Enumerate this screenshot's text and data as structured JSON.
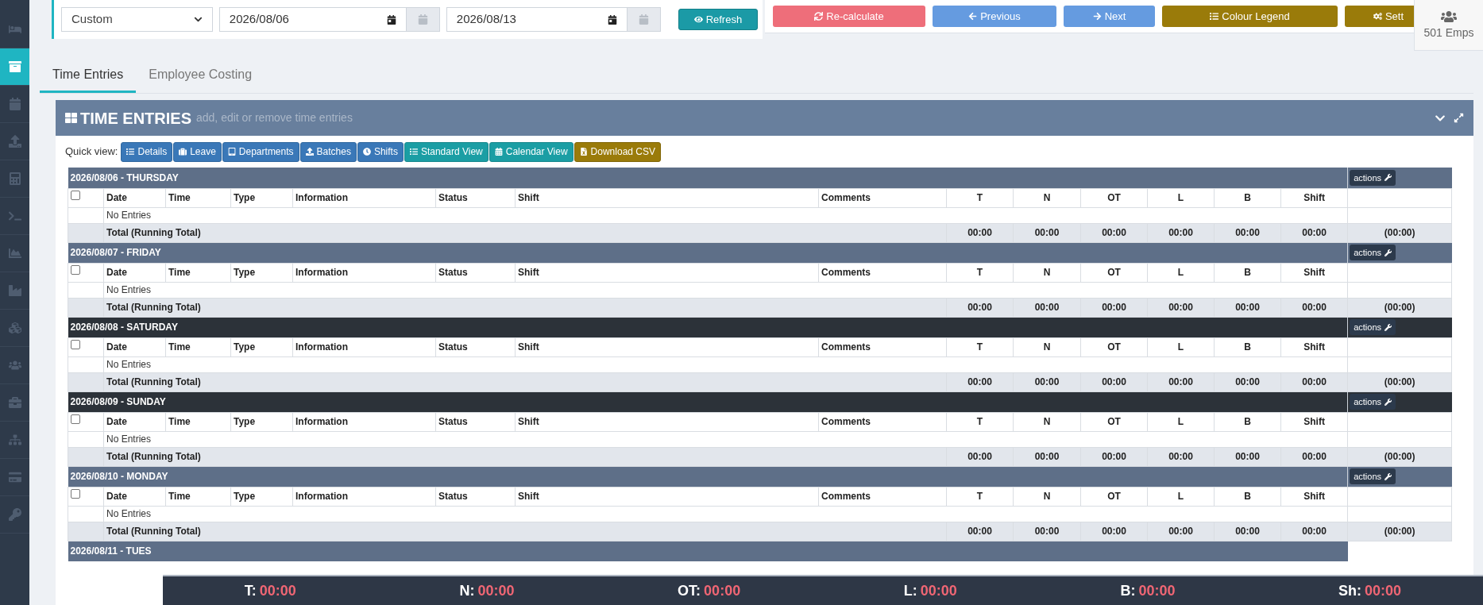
{
  "sidebar": {
    "items": [
      {
        "selected": false
      },
      {
        "selected": true
      },
      {
        "selected": false
      },
      {
        "selected": false
      },
      {
        "selected": false
      },
      {
        "selected": false
      },
      {
        "selected": false
      },
      {
        "selected": false
      },
      {
        "selected": false
      },
      {
        "selected": false
      },
      {
        "selected": false
      },
      {
        "selected": false
      },
      {
        "selected": false
      },
      {
        "selected": false
      }
    ]
  },
  "filter": {
    "range": "Custom",
    "start_date": "2026/08/06",
    "end_date": "2026/08/13",
    "refresh": "Refresh"
  },
  "toolbar": [
    {
      "label": "Re-calculate",
      "kind": "danger"
    },
    {
      "label": "Previous",
      "kind": "primary"
    },
    {
      "label": "Next",
      "kind": "primary"
    },
    {
      "label": "Colour Legend",
      "kind": "warning"
    },
    {
      "label": "Sett",
      "kind": "warning"
    }
  ],
  "employees_badge": "501 Emps",
  "tabs": [
    {
      "label": "Time Entries",
      "selected": true
    },
    {
      "label": "Employee Costing",
      "selected": false
    }
  ],
  "panel": {
    "title": "TIME ENTRIES",
    "subtitle": "add, edit or remove time entries"
  },
  "quick_view": {
    "label": "Quick view:",
    "buttons": [
      {
        "label": "Details",
        "kind": "primary"
      },
      {
        "label": "Leave",
        "kind": "primary"
      },
      {
        "label": "Departments",
        "kind": "primary"
      },
      {
        "label": "Batches",
        "kind": "primary"
      },
      {
        "label": "Shifts",
        "kind": "primary"
      },
      {
        "label": "Standard View",
        "kind": "info"
      },
      {
        "label": "Calendar View",
        "kind": "info"
      },
      {
        "label": "Download CSV",
        "kind": "warning"
      }
    ]
  },
  "days": [
    {
      "header": "2026/08/06 - THURSDAY",
      "kind": "weekday",
      "actions": "actions",
      "checked": false,
      "columns": [
        "Date",
        "Time",
        "Type",
        "Information",
        "Status",
        "Shift",
        "Comments",
        "T",
        "N",
        "OT",
        "L",
        "B",
        "Shift"
      ],
      "empty": "No Entries",
      "total_label": "Total (Running Total)",
      "totals": [
        "00:00",
        "00:00",
        "00:00",
        "00:00",
        "00:00",
        "00:00"
      ],
      "running": "(00:00)"
    },
    {
      "header": "2026/08/07 - FRIDAY",
      "kind": "weekday",
      "actions": "actions",
      "checked": false,
      "columns": [
        "Date",
        "Time",
        "Type",
        "Information",
        "Status",
        "Shift",
        "Comments",
        "T",
        "N",
        "OT",
        "L",
        "B",
        "Shift"
      ],
      "empty": "No Entries",
      "total_label": "Total (Running Total)",
      "totals": [
        "00:00",
        "00:00",
        "00:00",
        "00:00",
        "00:00",
        "00:00"
      ],
      "running": "(00:00)"
    },
    {
      "header": "2026/08/08 - SATURDAY",
      "kind": "weekend",
      "actions": "actions",
      "checked": false,
      "columns": [
        "Date",
        "Time",
        "Type",
        "Information",
        "Status",
        "Shift",
        "Comments",
        "T",
        "N",
        "OT",
        "L",
        "B",
        "Shift"
      ],
      "empty": "No Entries",
      "total_label": "Total (Running Total)",
      "totals": [
        "00:00",
        "00:00",
        "00:00",
        "00:00",
        "00:00",
        "00:00"
      ],
      "running": "(00:00)"
    },
    {
      "header": "2026/08/09 - SUNDAY",
      "kind": "weekend",
      "actions": "actions",
      "checked": false,
      "columns": [
        "Date",
        "Time",
        "Type",
        "Information",
        "Status",
        "Shift",
        "Comments",
        "T",
        "N",
        "OT",
        "L",
        "B",
        "Shift"
      ],
      "empty": "No Entries",
      "total_label": "Total (Running Total)",
      "totals": [
        "00:00",
        "00:00",
        "00:00",
        "00:00",
        "00:00",
        "00:00"
      ],
      "running": "(00:00)"
    },
    {
      "header": "2026/08/10 - MONDAY",
      "kind": "weekday",
      "actions": "actions",
      "checked": false,
      "columns": [
        "Date",
        "Time",
        "Type",
        "Information",
        "Status",
        "Shift",
        "Comments",
        "T",
        "N",
        "OT",
        "L",
        "B",
        "Shift"
      ],
      "empty": "No Entries",
      "total_label": "Total (Running Total)",
      "totals": [
        "00:00",
        "00:00",
        "00:00",
        "00:00",
        "00:00",
        "00:00"
      ],
      "running": "(00:00)"
    },
    {
      "header": "2026/08/11 - TUES",
      "kind": "weekday"
    }
  ],
  "footer": [
    {
      "label": "T:",
      "value": "00:00"
    },
    {
      "label": "N:",
      "value": "00:00"
    },
    {
      "label": "OT:",
      "value": "00:00"
    },
    {
      "label": "L:",
      "value": "00:00"
    },
    {
      "label": "B:",
      "value": "00:00"
    },
    {
      "label": "Sh:",
      "value": "00:00"
    }
  ]
}
